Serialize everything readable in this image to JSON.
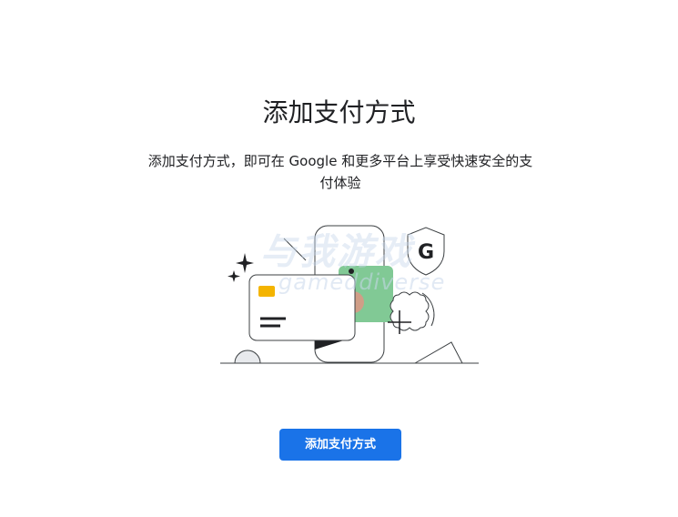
{
  "page": {
    "title": "添加支付方式",
    "description": "添加支付方式，即可在 Google 和更多平台上享受快速安全的支付体验",
    "add_payment_button_label": "添加支付方式"
  },
  "illustration": {
    "shield_letter": "G",
    "watermark_line1": "与我游戏",
    "watermark_line2": "gameddiverse"
  },
  "colors": {
    "primary": "#1a73e8",
    "card_chip": "#f4b400",
    "card_green": "#81c995",
    "card_pink": "#f28b82",
    "text": "#202124"
  }
}
